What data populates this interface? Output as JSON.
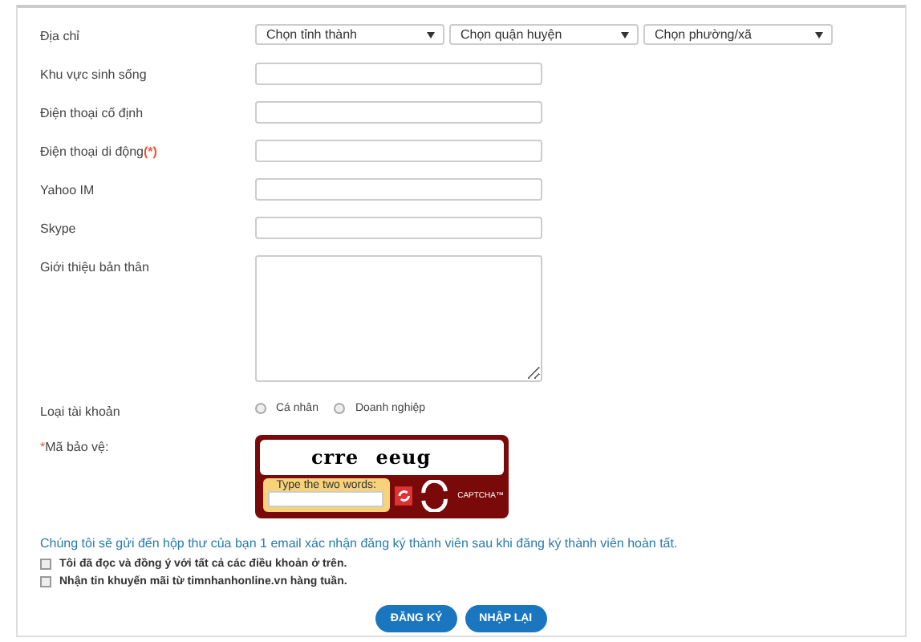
{
  "address": {
    "label": "Địa chỉ",
    "selects": [
      "Chọn tỉnh thành",
      "Chọn quận huyện",
      "Chọn phường/xã"
    ]
  },
  "fields": [
    {
      "label": "Khu vực sinh sống"
    },
    {
      "label": "Điện thoại cố định"
    },
    {
      "label": "Điện thoại di động",
      "required_mark": "(*)"
    },
    {
      "label": "Yahoo IM"
    },
    {
      "label": "Skype"
    }
  ],
  "intro": {
    "label": "Giới thiệu bản thân"
  },
  "account_type": {
    "label": "Loại tài khoản",
    "options": [
      {
        "label": "Cá nhân",
        "selected": false
      },
      {
        "label": "Doanh nghiệp",
        "selected": false
      }
    ]
  },
  "captcha": {
    "required_mark": "*",
    "label": "Mã bảo vệ:",
    "words": "crre eeug",
    "prompt": "Type the two words:",
    "brand": "CAPTCHA™"
  },
  "notice": "Chúng tôi sẽ gửi đến hộp thư của bạn 1 email xác nhận đăng ký thành viên sau khi đăng ký thành viên hoàn tất.",
  "checkboxes": [
    {
      "label": "Tôi đã đọc và đồng ý với tất cả các điều khoản ở trên.",
      "checked": false
    },
    {
      "label": "Nhận tin khuyến mãi từ timnhanhonline.vn hàng tuần.",
      "checked": false
    }
  ],
  "buttons": [
    "ĐĂNG KÝ",
    "NHẬP LẠI"
  ]
}
